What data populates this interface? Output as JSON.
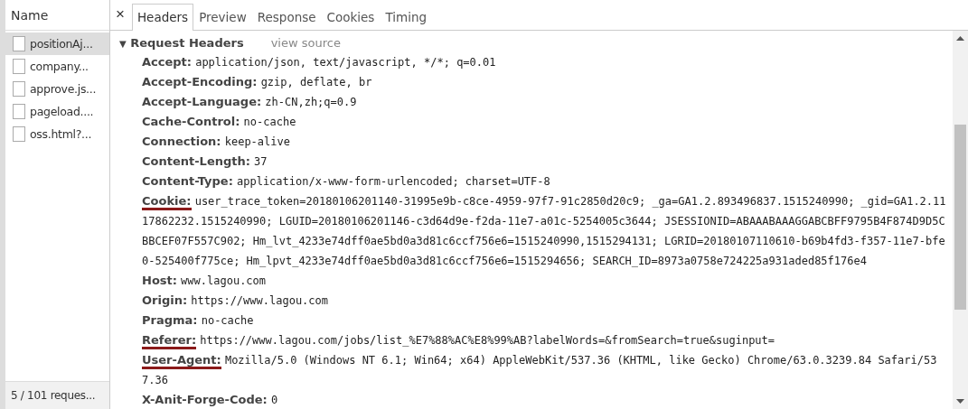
{
  "requests_panel": {
    "header": "Name",
    "items": [
      {
        "name": "positionAj...",
        "selected": true
      },
      {
        "name": "company...",
        "selected": false
      },
      {
        "name": "approve.js...",
        "selected": false
      },
      {
        "name": "pageload....",
        "selected": false
      },
      {
        "name": "oss.html?...",
        "selected": false
      }
    ],
    "status": "5 / 101 reques..."
  },
  "tabs": [
    {
      "label": "Headers",
      "selected": true
    },
    {
      "label": "Preview",
      "selected": false
    },
    {
      "label": "Response",
      "selected": false
    },
    {
      "label": "Cookies",
      "selected": false
    },
    {
      "label": "Timing",
      "selected": false
    }
  ],
  "close": "×",
  "section": {
    "title": "Request Headers",
    "expanded": true,
    "toggle": "▼",
    "link": "view source",
    "headers": [
      {
        "name": "Accept:",
        "value": "application/json, text/javascript, */*; q=0.01",
        "underlined": false
      },
      {
        "name": "Accept-Encoding:",
        "value": "gzip, deflate, br",
        "underlined": false
      },
      {
        "name": "Accept-Language:",
        "value": "zh-CN,zh;q=0.9",
        "underlined": false
      },
      {
        "name": "Cache-Control:",
        "value": "no-cache",
        "underlined": false
      },
      {
        "name": "Connection:",
        "value": "keep-alive",
        "underlined": false
      },
      {
        "name": "Content-Length:",
        "value": "37",
        "underlined": false
      },
      {
        "name": "Content-Type:",
        "value": "application/x-www-form-urlencoded; charset=UTF-8",
        "underlined": false
      },
      {
        "name": "Cookie:",
        "value": "user_trace_token=20180106201140-31995e9b-c8ce-4959-97f7-91c2850d20c9; _ga=GA1.2.893496837.1515240990; _gid=GA1.2.1117862232.1515240990; LGUID=20180106201146-c3d64d9e-f2da-11e7-a01c-5254005c3644; JSESSIONID=ABAAABAAAGGABCBFF9795B4F874D9D5CBBCEF07F557C902; Hm_lvt_4233e74dff0ae5bd0a3d81c6ccf756e6=1515240990,1515294131; LGRID=20180107110610-b69b4fd3-f357-11e7-bfe0-525400f775ce; Hm_lpvt_4233e74dff0ae5bd0a3d81c6ccf756e6=1515294656; SEARCH_ID=8973a0758e724225a931aded85f176e4",
        "underlined": true
      },
      {
        "name": "Host:",
        "value": "www.lagou.com",
        "underlined": false
      },
      {
        "name": "Origin:",
        "value": "https://www.lagou.com",
        "underlined": false
      },
      {
        "name": "Pragma:",
        "value": "no-cache",
        "underlined": false
      },
      {
        "name": "Referer:",
        "value": "https://www.lagou.com/jobs/list_%E7%88%AC%E8%99%AB?labelWords=&fromSearch=true&suginput=",
        "underlined": true
      },
      {
        "name": "User-Agent:",
        "value": "Mozilla/5.0 (Windows NT 6.1; Win64; x64) AppleWebKit/537.36 (KHTML, like Gecko) Chrome/63.0.3239.84 Safari/537.36",
        "underlined": true
      },
      {
        "name": "X-Anit-Forge-Code:",
        "value": "0",
        "underlined": false
      }
    ]
  }
}
